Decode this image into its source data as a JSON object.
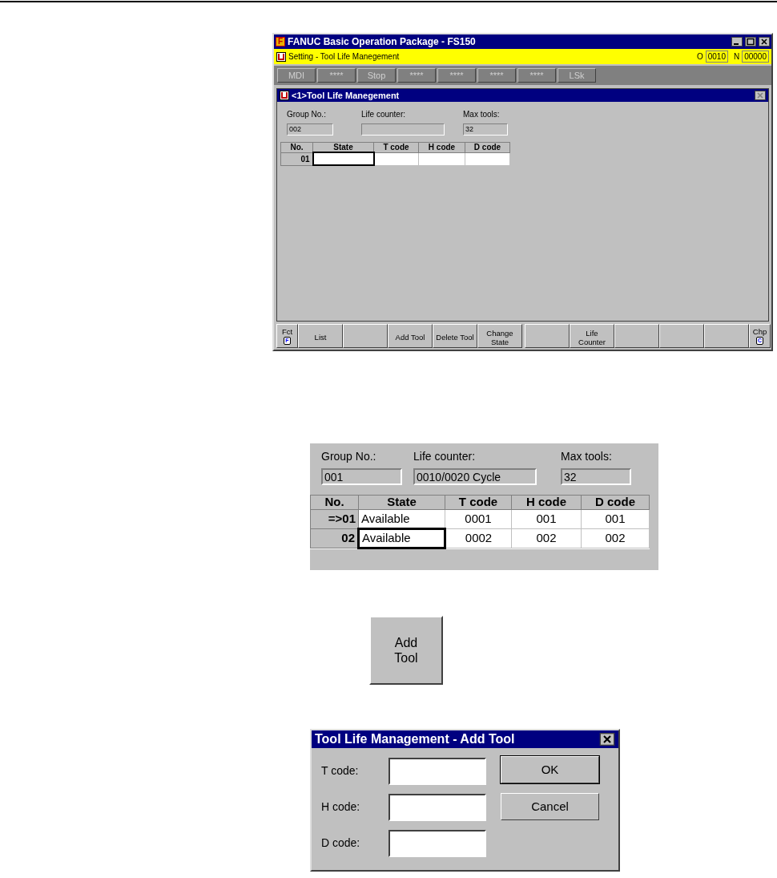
{
  "main_window": {
    "logo": "F",
    "title": "FANUC Basic Operation Package - FS150",
    "status_bar": {
      "title": "Setting - Tool Life Manegement",
      "o_label": "O",
      "o_value": "0010",
      "n_label": "N",
      "n_value": "00000"
    },
    "mode_buttons": [
      {
        "label": "MDI"
      },
      {
        "label": "****"
      },
      {
        "label": "Stop"
      },
      {
        "label": "****"
      },
      {
        "label": "****"
      },
      {
        "label": "****"
      },
      {
        "label": "****"
      },
      {
        "label": "LSk"
      }
    ],
    "subwindow": {
      "title": "<1>Tool Life Manegement",
      "fields": [
        {
          "label": "Group No.:",
          "value": "002"
        },
        {
          "label": "Life counter:"
        },
        {
          "label": "Max tools:",
          "value": "32"
        }
      ],
      "table": {
        "columns": [
          "No.",
          "State",
          "T code",
          "H code",
          "D code"
        ],
        "rows": [
          {
            "cells": [
              {
                "kind": "row_header",
                "text": "01",
                "focused": false
              },
              {
                "kind": "data",
                "focused": true
              },
              {
                "kind": "data",
                "focused": false
              },
              {
                "kind": "data",
                "focused": false
              },
              {
                "kind": "data",
                "focused": false
              }
            ]
          }
        ]
      }
    },
    "soft_key_groups": [
      [
        {
          "kind": "edge",
          "label": "Fct",
          "icon_letter": "F"
        },
        {
          "kind": "key",
          "label": "List"
        },
        {
          "kind": "blank"
        },
        {
          "kind": "key",
          "label": "Add Tool"
        },
        {
          "kind": "key",
          "label": "Delete Tool"
        },
        {
          "kind": "key",
          "label": "Change State"
        }
      ],
      [
        {
          "kind": "blank"
        },
        {
          "kind": "key",
          "label": "Life Counter"
        },
        {
          "kind": "blank"
        },
        {
          "kind": "blank"
        },
        {
          "kind": "blank"
        },
        {
          "kind": "edge",
          "label": "Chp",
          "icon_letter": "C"
        }
      ]
    ]
  },
  "detail_panel": {
    "fields": [
      {
        "label": "Group No.:",
        "value": "001"
      },
      {
        "label": "Life counter:",
        "value": "0010/0020 Cycle"
      },
      {
        "label": "Max tools:",
        "value": "32"
      }
    ],
    "table": {
      "columns": [
        "No.",
        "State",
        "T code",
        "H code",
        "D code"
      ],
      "rows": [
        {
          "cells": [
            {
              "kind": "row_header",
              "text": "=>01",
              "focused": false
            },
            {
              "kind": "data",
              "text": "Available",
              "focused": false
            },
            {
              "kind": "data",
              "text": "0001",
              "focused": false
            },
            {
              "kind": "data",
              "text": "001",
              "focused": false
            },
            {
              "kind": "data",
              "text": "001",
              "focused": false
            }
          ]
        },
        {
          "cells": [
            {
              "kind": "row_header",
              "text": "02",
              "focused": false
            },
            {
              "kind": "data",
              "text": "Available",
              "focused": true
            },
            {
              "kind": "data",
              "text": "0002",
              "focused": false
            },
            {
              "kind": "data",
              "text": "002",
              "focused": false
            },
            {
              "kind": "data",
              "text": "002",
              "focused": false
            }
          ]
        }
      ]
    }
  },
  "add_tool_button": {
    "label": "Add Tool"
  },
  "dialog": {
    "title": "Tool Life Management - Add Tool",
    "fields": [
      {
        "label": "T code:"
      },
      {
        "label": "H code:"
      },
      {
        "label": "D code:"
      }
    ],
    "buttons": [
      {
        "label": "OK",
        "default": true
      },
      {
        "label": "Cancel",
        "default": false
      }
    ]
  }
}
